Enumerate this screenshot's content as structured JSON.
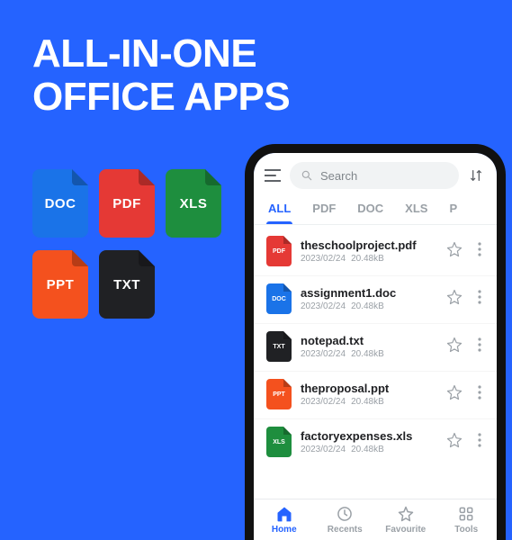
{
  "hero": {
    "line1": "ALL-IN-ONE",
    "line2": "OFFICE APPS"
  },
  "promo_badges": [
    {
      "type": "doc",
      "label": "DOC"
    },
    {
      "type": "pdf",
      "label": "PDF"
    },
    {
      "type": "xls",
      "label": "XLS"
    },
    {
      "type": "ppt",
      "label": "PPT"
    },
    {
      "type": "txt",
      "label": "TXT"
    }
  ],
  "search": {
    "placeholder": "Search"
  },
  "tabs": [
    {
      "label": "ALL",
      "active": true
    },
    {
      "label": "PDF",
      "active": false
    },
    {
      "label": "DOC",
      "active": false
    },
    {
      "label": "XLS",
      "active": false
    },
    {
      "label": "P",
      "active": false
    }
  ],
  "files": [
    {
      "type": "pdf",
      "badge": "PDF",
      "name": "theschoolproject.pdf",
      "date": "2023/02/24",
      "size": "20.48kB"
    },
    {
      "type": "doc",
      "badge": "DOC",
      "name": "assignment1.doc",
      "date": "2023/02/24",
      "size": "20.48kB"
    },
    {
      "type": "txt",
      "badge": "TXT",
      "name": "notepad.txt",
      "date": "2023/02/24",
      "size": "20.48kB"
    },
    {
      "type": "ppt",
      "badge": "PPT",
      "name": "theproposal.ppt",
      "date": "2023/02/24",
      "size": "20.48kB"
    },
    {
      "type": "xls",
      "badge": "XLS",
      "name": "factoryexpenses.xls",
      "date": "2023/02/24",
      "size": "20.48kB"
    }
  ],
  "nav": [
    {
      "label": "Home",
      "icon": "home",
      "active": true
    },
    {
      "label": "Recents",
      "icon": "clock",
      "active": false
    },
    {
      "label": "Favourite",
      "icon": "star",
      "active": false
    },
    {
      "label": "Tools",
      "icon": "grid",
      "active": false
    }
  ]
}
